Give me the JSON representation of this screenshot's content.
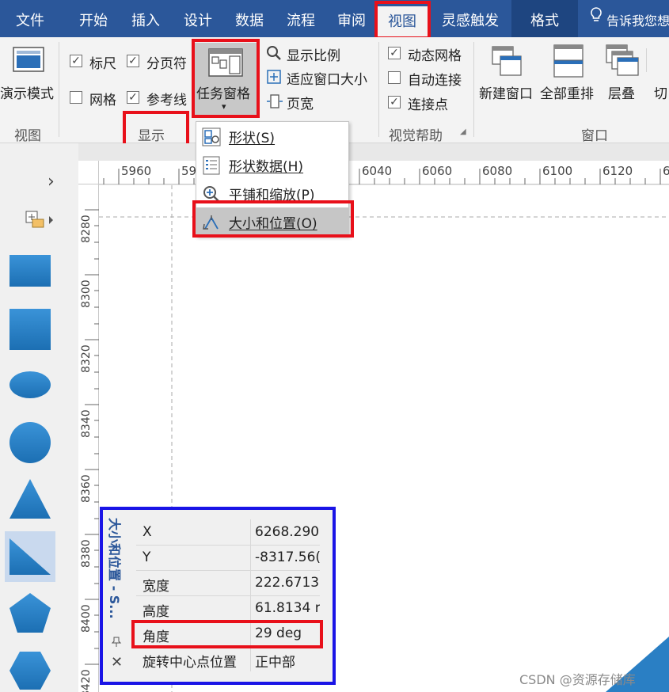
{
  "tabs": [
    {
      "label": "文件"
    },
    {
      "label": "开始"
    },
    {
      "label": "插入"
    },
    {
      "label": "设计"
    },
    {
      "label": "数据"
    },
    {
      "label": "流程"
    },
    {
      "label": "审阅"
    },
    {
      "label": "视图"
    },
    {
      "label": "灵感触发"
    },
    {
      "label": "格式"
    },
    {
      "label": "告诉我您想"
    }
  ],
  "ribbon": {
    "view_group": {
      "button": "演示模式",
      "label": "视图"
    },
    "show_group": {
      "label": "显示",
      "checkboxes": [
        {
          "label": "标尺",
          "checked": true
        },
        {
          "label": "分页符",
          "checked": true
        },
        {
          "label": "网格",
          "checked": false
        },
        {
          "label": "参考线",
          "checked": true
        }
      ],
      "task_pane_button": "任务窗格"
    },
    "zoom": {
      "show_ratio": "显示比例",
      "fit_window": "适应窗口大小",
      "page_width": "页宽"
    },
    "visual_aids": {
      "label": "视觉帮助",
      "checkboxes": [
        {
          "label": "动态网格",
          "checked": true
        },
        {
          "label": "自动连接",
          "checked": false
        },
        {
          "label": "连接点",
          "checked": true
        }
      ]
    },
    "window_group": {
      "label": "窗口",
      "buttons": [
        "新建窗口",
        "全部重排",
        "层叠",
        "切"
      ]
    }
  },
  "task_pane_menu": {
    "items": [
      {
        "label": "形状(S)",
        "icon": "shapes-icon"
      },
      {
        "label": "形状数据(H)",
        "icon": "shape-data-icon"
      },
      {
        "label": "平铺和缩放(P)",
        "icon": "pan-zoom-icon"
      },
      {
        "label": "大小和位置(O)",
        "icon": "size-position-icon",
        "selected": true
      }
    ]
  },
  "rulers": {
    "horizontal": [
      "5960",
      "59",
      "6040",
      "6060",
      "6080",
      "6100",
      "6120",
      "6"
    ],
    "vertical": [
      "8280",
      "8300",
      "8320",
      "8340",
      "8360",
      "8380",
      "8400",
      "8420"
    ]
  },
  "stencil": {
    "expand_glyph": "›",
    "shapes": [
      "rectangle",
      "square",
      "ellipse",
      "circle",
      "triangle",
      "right-triangle",
      "pentagon",
      "hexagon"
    ]
  },
  "size_position_window": {
    "title": "大小和位置 - S...",
    "rows": [
      {
        "label": "X",
        "value": "6268.290"
      },
      {
        "label": "Y",
        "value": "-8317.56("
      },
      {
        "label": "宽度",
        "value": "222.6713"
      },
      {
        "label": "高度",
        "value": "61.8134 r"
      },
      {
        "label": "角度",
        "value": "29 deg"
      },
      {
        "label": "旋转中心点位置",
        "value": "正中部"
      }
    ],
    "pin_glyph": "📌",
    "close_glyph": "✕"
  },
  "watermark": "CSDN @资源存储库",
  "colors": {
    "ribbon_blue": "#2b579a",
    "highlight_red": "#e8101a",
    "highlight_blue": "#1a14e6",
    "shape_blue": "#2a7fc4"
  }
}
